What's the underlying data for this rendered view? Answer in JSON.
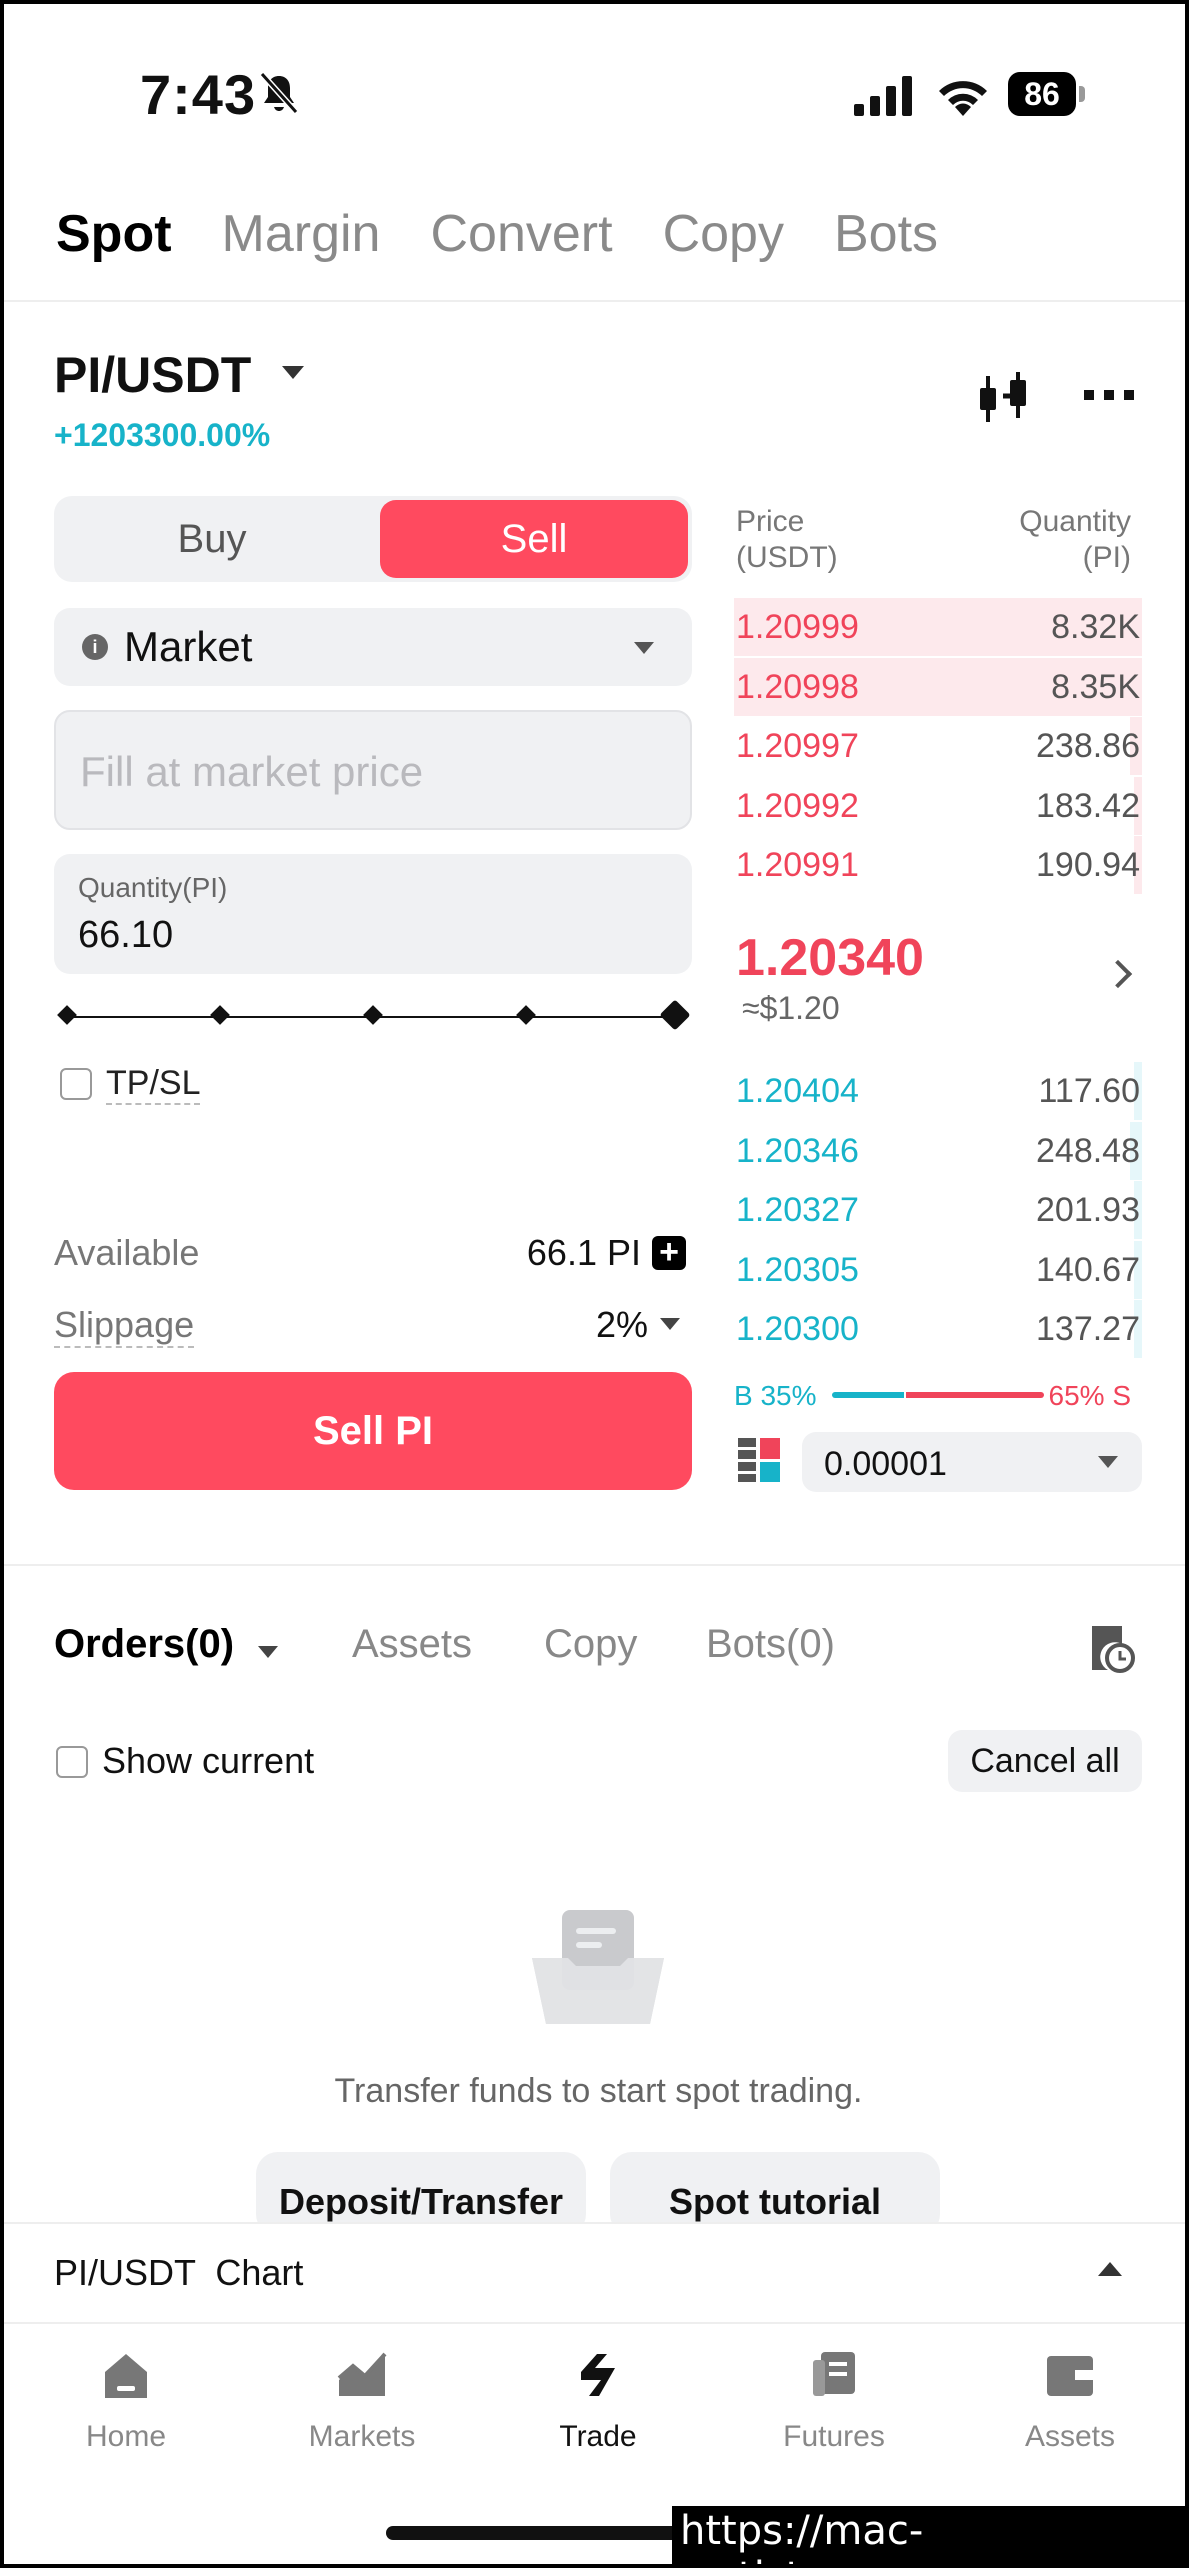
{
  "status_bar": {
    "time": "7:43",
    "battery": "86"
  },
  "top_tabs": [
    {
      "label": "Spot",
      "active": true
    },
    {
      "label": "Margin"
    },
    {
      "label": "Convert"
    },
    {
      "label": "Copy"
    },
    {
      "label": "Bots"
    }
  ],
  "pair": {
    "name": "PI/USDT",
    "change": "+1203300.00%"
  },
  "trade_form": {
    "buy_label": "Buy",
    "sell_label": "Sell",
    "order_type": "Market",
    "price_placeholder": "Fill at market price",
    "quantity_label": "Quantity(PI)",
    "quantity_value": "66.10",
    "slider_fraction": 1.0,
    "tpsl_label": "TP/SL",
    "available_label": "Available",
    "available_value": "66.1 PI",
    "slippage_label": "Slippage",
    "slippage_value": "2%",
    "submit_label": "Sell PI"
  },
  "order_book": {
    "price_header": "Price\n(USDT)",
    "price_header_l1": "Price",
    "price_header_l2": "(USDT)",
    "qty_header_l1": "Quantity",
    "qty_header_l2": "(PI)",
    "asks": [
      {
        "price": "1.20999",
        "qty": "8.32K",
        "depth": 1.0
      },
      {
        "price": "1.20998",
        "qty": "8.35K",
        "depth": 1.0
      },
      {
        "price": "1.20997",
        "qty": "238.86",
        "depth": 0.03
      },
      {
        "price": "1.20992",
        "qty": "183.42",
        "depth": 0.02
      },
      {
        "price": "1.20991",
        "qty": "190.94",
        "depth": 0.02
      }
    ],
    "last_price": "1.20340",
    "last_price_usd": "≈$1.20",
    "bids": [
      {
        "price": "1.20404",
        "qty": "117.60",
        "depth": 0.02
      },
      {
        "price": "1.20346",
        "qty": "248.48",
        "depth": 0.03
      },
      {
        "price": "1.20327",
        "qty": "201.93",
        "depth": 0.02
      },
      {
        "price": "1.20305",
        "qty": "140.67",
        "depth": 0.02
      },
      {
        "price": "1.20300",
        "qty": "137.27",
        "depth": 0.02
      }
    ],
    "buy_ratio": "B 35%",
    "sell_ratio": "65% S",
    "tick_size": "0.00001"
  },
  "orders_tabs": {
    "orders": "Orders(0)",
    "assets": "Assets",
    "copy": "Copy",
    "bots": "Bots(0)"
  },
  "orders_panel": {
    "show_current": "Show current",
    "cancel_all": "Cancel all",
    "empty_text": "Transfer funds to start spot trading.",
    "deposit_label": "Deposit/Transfer",
    "tutorial_label": "Spot tutorial"
  },
  "chart_bar": {
    "label": "PI/USDT  Chart"
  },
  "bottom_nav": [
    {
      "label": "Home",
      "icon": "home-icon"
    },
    {
      "label": "Markets",
      "icon": "markets-icon"
    },
    {
      "label": "Trade",
      "icon": "trade-icon",
      "active": true
    },
    {
      "label": "Futures",
      "icon": "futures-icon"
    },
    {
      "label": "Assets",
      "icon": "wallet-icon"
    }
  ],
  "watermark": "https://mac-os.tistory.com",
  "colors": {
    "sell": "#ff4a5f",
    "buy": "#17b3c9"
  }
}
